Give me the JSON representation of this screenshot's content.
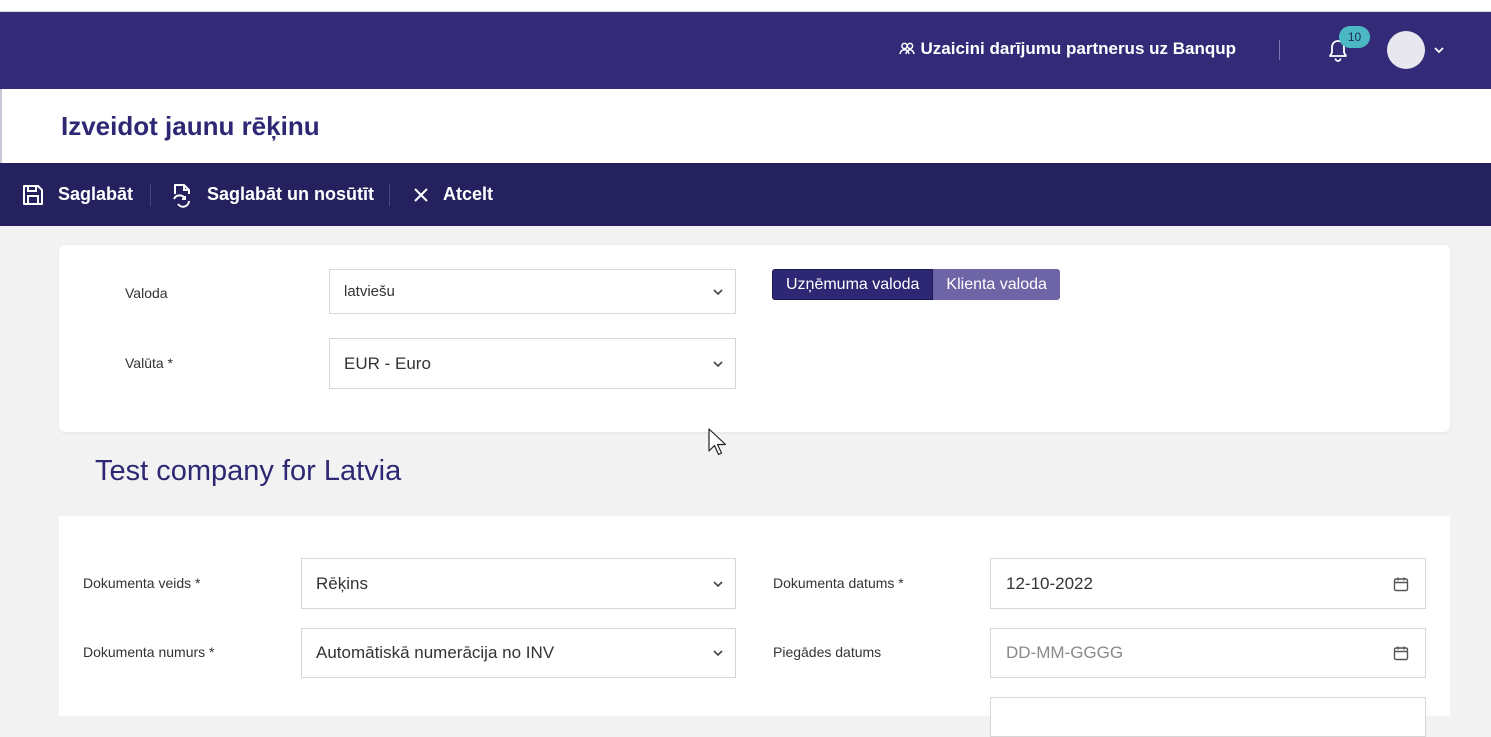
{
  "header": {
    "invite_label": "Uzaicini darījumu partnerus uz Banqup",
    "notification_count": "10",
    "colors": {
      "brand": "#332b77",
      "badge": "#4cb8c4"
    }
  },
  "page": {
    "title": "Izveidot jaunu rēķinu"
  },
  "toolbar": {
    "save_label": "Saglabāt",
    "save_send_label": "Saglabāt un nosūtīt",
    "cancel_label": "Atcelt"
  },
  "settings": {
    "language_label": "Valoda",
    "language_value": "latviešu",
    "company_lang_label": "Uzņēmuma valoda",
    "client_lang_label": "Klienta valoda",
    "currency_label": "Valūta *",
    "currency_value": "EUR - Euro"
  },
  "company": {
    "name": "Test company for Latvia"
  },
  "document": {
    "type_label": "Dokumenta veids *",
    "type_value": "Rēķins",
    "number_label": "Dokumenta numurs *",
    "number_value": "Automātiskā numerācija no INV",
    "date_label": "Dokumenta datums *",
    "date_value": "12-10-2022",
    "delivery_label": "Piegādes datums",
    "delivery_placeholder": "DD-MM-GGGG"
  }
}
